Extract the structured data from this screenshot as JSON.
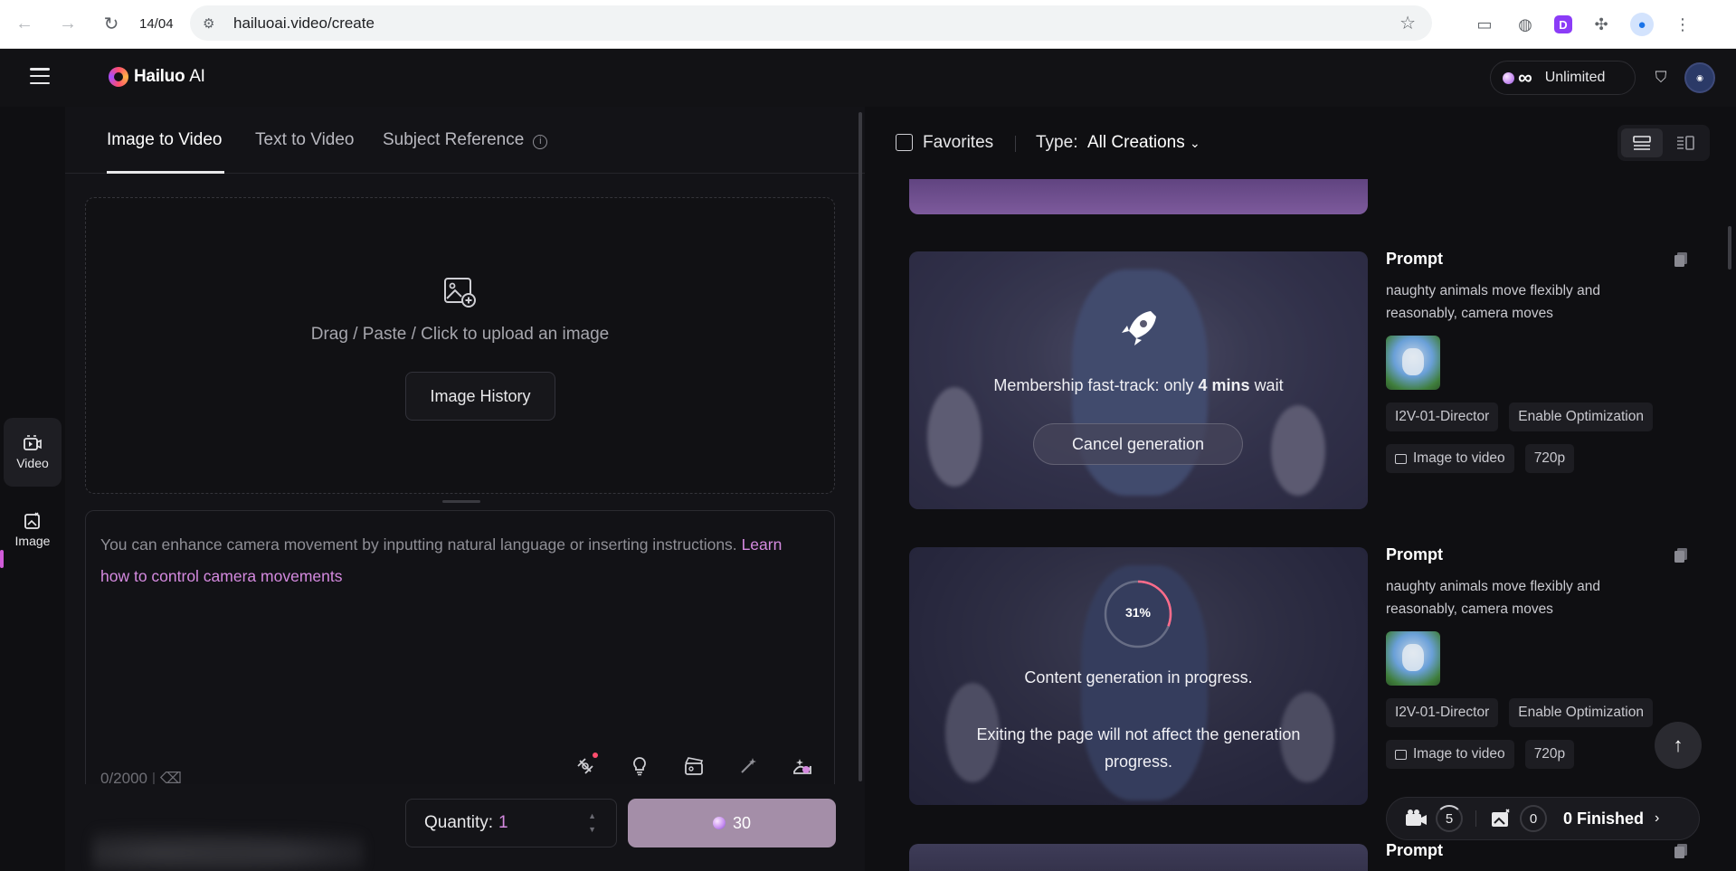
{
  "browser": {
    "tab_counter": "14/04",
    "url": "hailuoai.video/create"
  },
  "header": {
    "logo_text": "Hailuo",
    "logo_ai": "AI",
    "credits_symbol": "∞",
    "plan_label": "Unlimited"
  },
  "rail": {
    "video_label": "Video",
    "image_label": "Image"
  },
  "tabs": [
    {
      "label": "Image to Video",
      "active": true
    },
    {
      "label": "Text to Video",
      "active": false
    },
    {
      "label": "Subject Reference",
      "active": false
    }
  ],
  "upload": {
    "text": "Drag / Paste / Click to upload an image",
    "history_button": "Image History"
  },
  "prompt": {
    "placeholder": "You can enhance camera movement by inputting natural language or inserting instructions.",
    "link_text": "Learn how to control camera movements",
    "counter": "0/2000"
  },
  "generate": {
    "quantity_label": "Quantity:",
    "quantity_value": "1",
    "cost": "30"
  },
  "filters": {
    "favorites_label": "Favorites",
    "type_label": "Type:",
    "type_value": "All Creations"
  },
  "cards": [
    {
      "status_text_pre": "Membership fast-track: only",
      "status_text_bold": "4 mins",
      "status_text_post": "wait",
      "cancel_label": "Cancel generation",
      "title": "Prompt",
      "prompt": "naughty animals move flexibly and reasonably, camera moves",
      "tags": [
        "I2V-01-Director",
        "Enable Optimization",
        "Image to video",
        "720p"
      ]
    },
    {
      "progress": "31%",
      "status_line1": "Content generation in progress.",
      "status_line2": "Exiting the page will not affect the generation progress.",
      "title": "Prompt",
      "prompt": "naughty animals move flexibly and reasonably, camera moves",
      "tags": [
        "I2V-01-Director",
        "Enable Optimization",
        "Image to video",
        "720p"
      ]
    },
    {
      "title": "Prompt"
    }
  ],
  "queue": {
    "generating_count": "5",
    "image_count": "0",
    "finished_count": "0",
    "finished_label": "Finished"
  },
  "colors": {
    "accent": "#d58ae0",
    "generate_button": "#a48ea8"
  }
}
